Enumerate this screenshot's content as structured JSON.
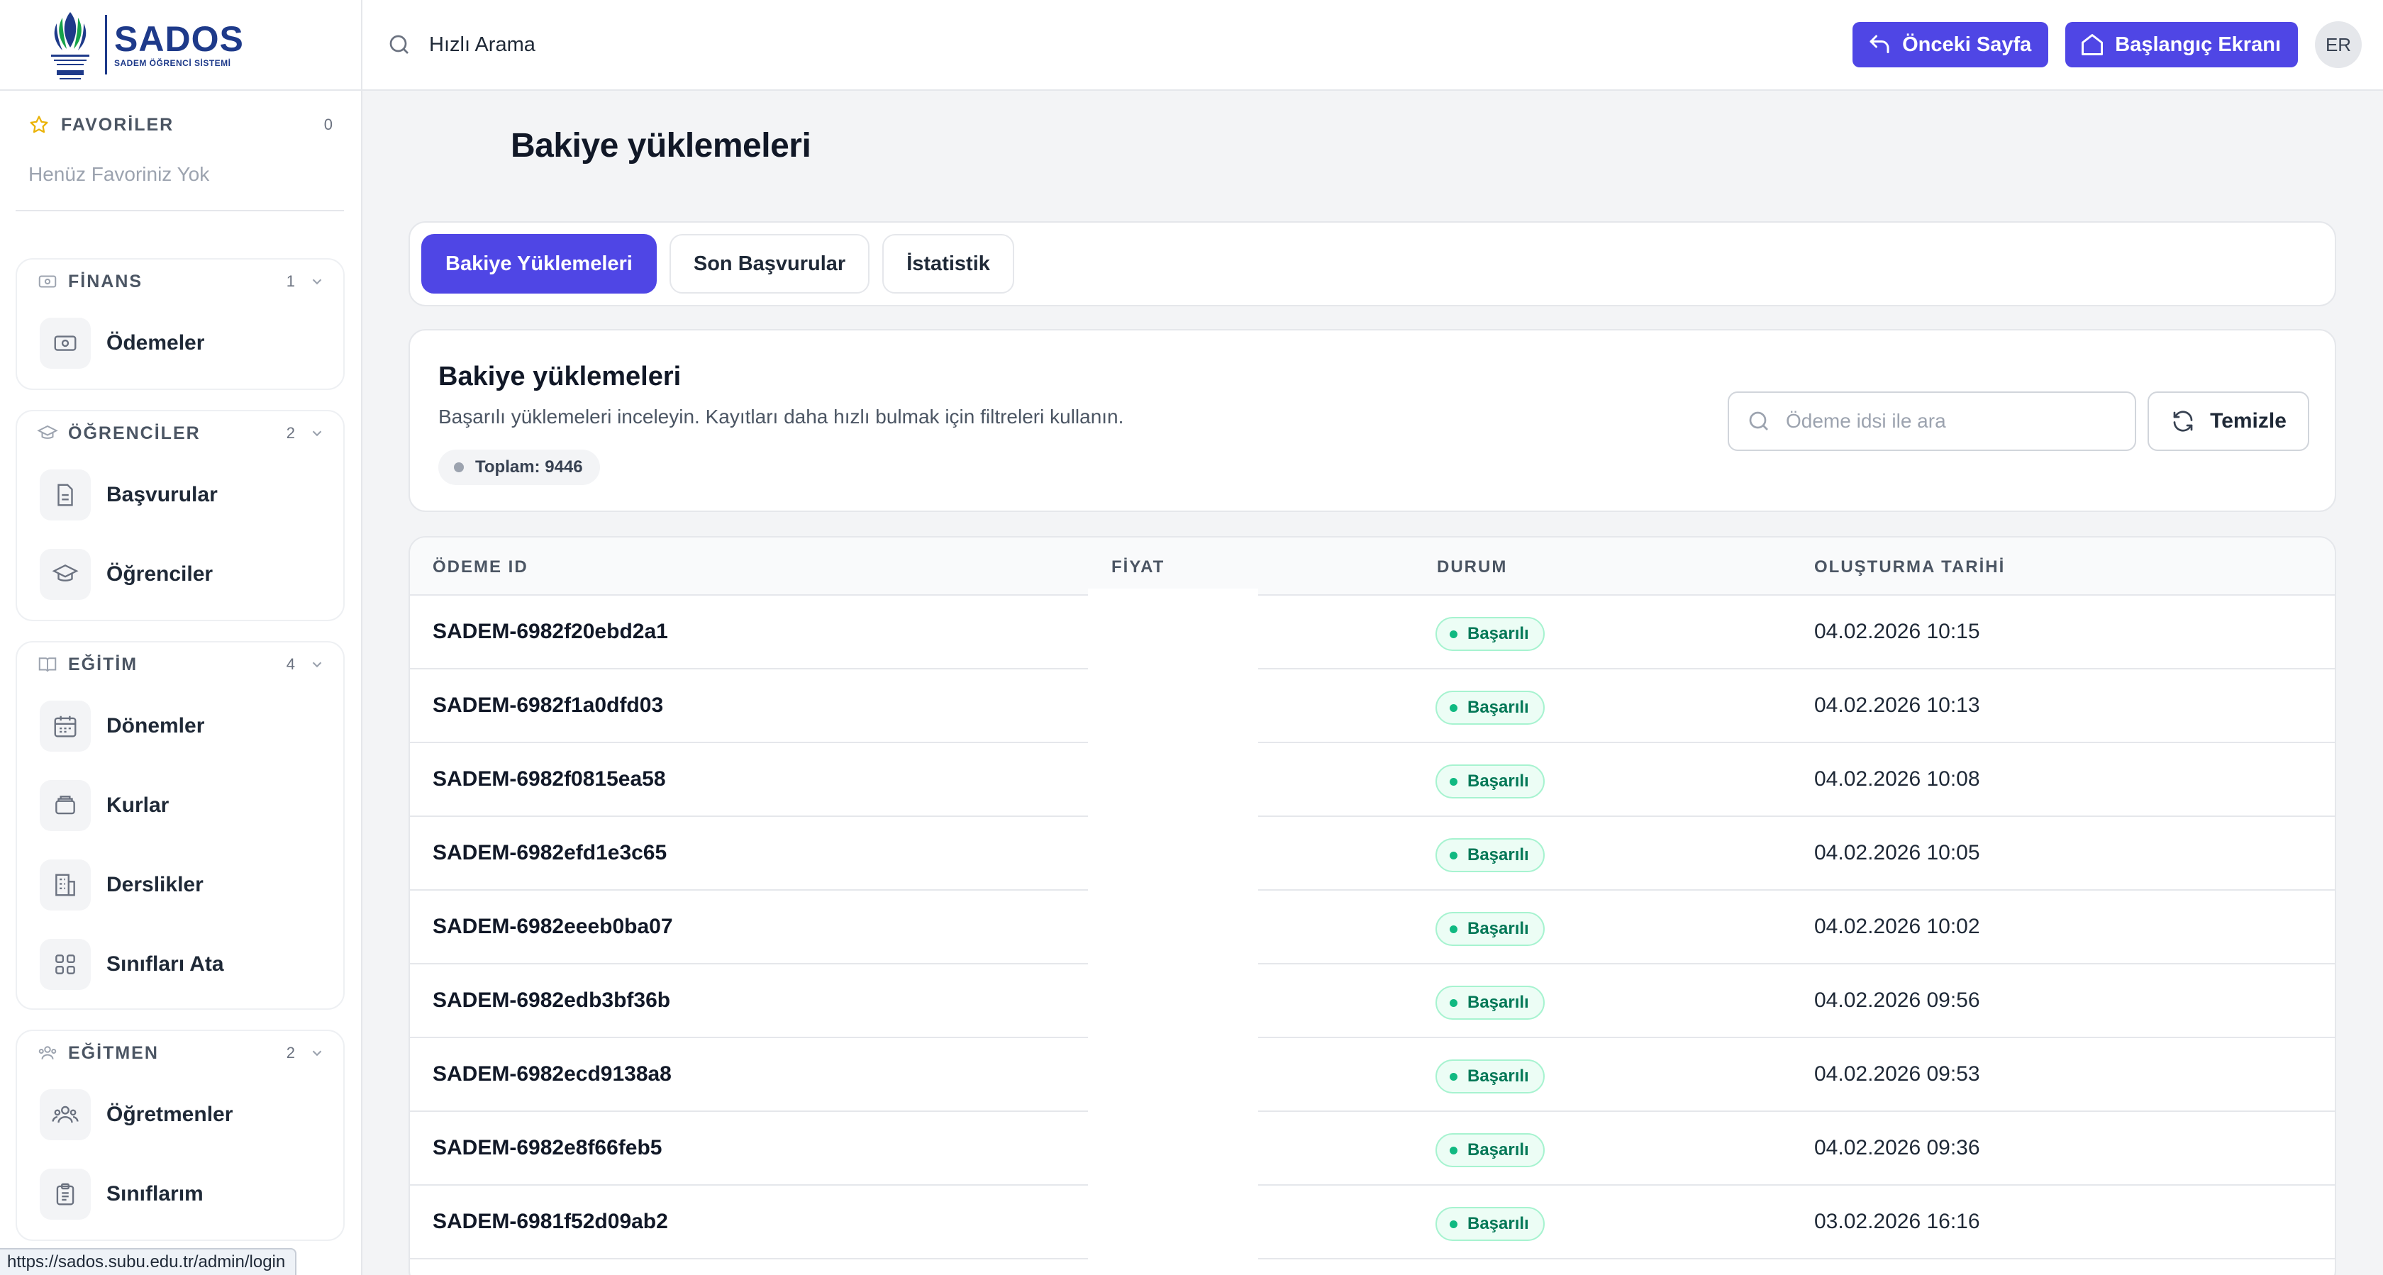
{
  "brand": {
    "name": "SADOS",
    "subtitle": "SADEM ÖĞRENCİ SİSTEMİ"
  },
  "favorites": {
    "title": "FAVORİLER",
    "count": "0",
    "empty_text": "Henüz Favoriniz Yok"
  },
  "groups": {
    "finans": {
      "title": "FİNANS",
      "count": "1",
      "items": [
        {
          "label": "Ödemeler"
        }
      ]
    },
    "ogrenciler": {
      "title": "ÖĞRENCİLER",
      "count": "2",
      "items": [
        {
          "label": "Başvurular"
        },
        {
          "label": "Öğrenciler"
        }
      ]
    },
    "egitim": {
      "title": "EĞİTİM",
      "count": "4",
      "items": [
        {
          "label": "Dönemler"
        },
        {
          "label": "Kurlar"
        },
        {
          "label": "Derslikler"
        },
        {
          "label": "Sınıfları Ata"
        }
      ]
    },
    "egitmen": {
      "title": "EĞİTMEN",
      "count": "2",
      "items": [
        {
          "label": "Öğretmenler"
        },
        {
          "label": "Sınıflarım"
        }
      ]
    }
  },
  "status_bar_url": "https://sados.subu.edu.tr/admin/login",
  "topbar": {
    "search_text": "Hızlı Arama",
    "back_label": "Önceki Sayfa",
    "home_label": "Başlangıç Ekranı",
    "avatar_initials": "ER"
  },
  "page": {
    "title": "Bakiye yüklemeleri"
  },
  "tabs": [
    {
      "label": "Bakiye Yüklemeleri",
      "active": true
    },
    {
      "label": "Son Başvurular",
      "active": false
    },
    {
      "label": "İstatistik",
      "active": false
    }
  ],
  "info": {
    "title": "Bakiye yüklemeleri",
    "description": "Başarılı yüklemeleri inceleyin. Kayıtları daha hızlı bulmak için filtreleri kullanın.",
    "total": "Toplam: 9446",
    "search_placeholder": "Ödeme idsi ile ara",
    "clear_label": "Temizle"
  },
  "table": {
    "columns": [
      "ÖDEME ID",
      "FİYAT",
      "DURUM",
      "OLUŞTURMA TARİHİ"
    ],
    "rows": [
      {
        "id": "SADEM-6982f20ebd2a1",
        "status": "Başarılı",
        "date": "04.02.2026 10:15"
      },
      {
        "id": "SADEM-6982f1a0dfd03",
        "status": "Başarılı",
        "date": "04.02.2026 10:13"
      },
      {
        "id": "SADEM-6982f0815ea58",
        "status": "Başarılı",
        "date": "04.02.2026 10:08"
      },
      {
        "id": "SADEM-6982efd1e3c65",
        "status": "Başarılı",
        "date": "04.02.2026 10:05"
      },
      {
        "id": "SADEM-6982eeeb0ba07",
        "status": "Başarılı",
        "date": "04.02.2026 10:02"
      },
      {
        "id": "SADEM-6982edb3bf36b",
        "status": "Başarılı",
        "date": "04.02.2026 09:56"
      },
      {
        "id": "SADEM-6982ecd9138a8",
        "status": "Başarılı",
        "date": "04.02.2026 09:53"
      },
      {
        "id": "SADEM-6982e8f66feb5",
        "status": "Başarılı",
        "date": "04.02.2026 09:36"
      },
      {
        "id": "SADEM-6981f52d09ab2",
        "status": "Başarılı",
        "date": "03.02.2026 16:16"
      }
    ]
  },
  "colors": {
    "accent": "#4f46e5",
    "brand": "#1e3a8a",
    "success": "#047857"
  }
}
